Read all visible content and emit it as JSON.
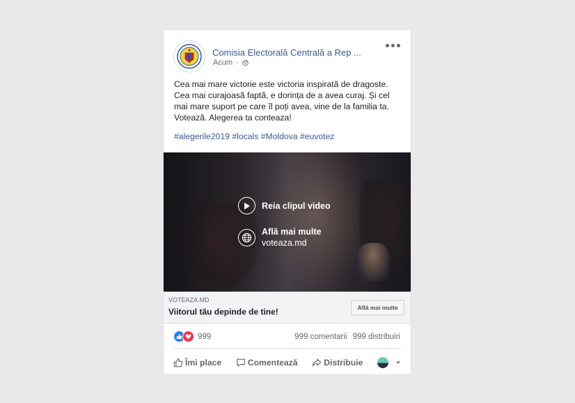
{
  "post": {
    "page_name": "Comisia Electorală Centrală a Rep ...",
    "timestamp": "Acum",
    "privacy_icon": "globe-icon",
    "body": "Cea mai mare victorie este victoria inspirată de dragoste. Cea mai curajoasă faptă, e dorința de a avea curaj. Și cel mai mare suport pe care îl poți avea, vine de la familia ta. Votează. Alegerea ta conteaza!",
    "hashtags": [
      "#alegerile2019",
      "#locals",
      "#Moldova",
      "#euvotez"
    ]
  },
  "video": {
    "replay_label": "Reia clipul video",
    "learn_more_label": "Află mai multe",
    "learn_more_url": "voteaza.md"
  },
  "link": {
    "domain": "VOTEAZA.MD",
    "title": "Viitorul tău depinde de tine!",
    "cta": "Află mai multe"
  },
  "engagement": {
    "reaction_count": "999",
    "comments": "999 comentarii",
    "shares": "999 distribuiri"
  },
  "actions": {
    "like": "Îmi place",
    "comment": "Comentează",
    "share": "Distribuie"
  },
  "colors": {
    "link_blue": "#385898",
    "like_blue": "#2f7bf5",
    "love_red": "#f0344d"
  }
}
